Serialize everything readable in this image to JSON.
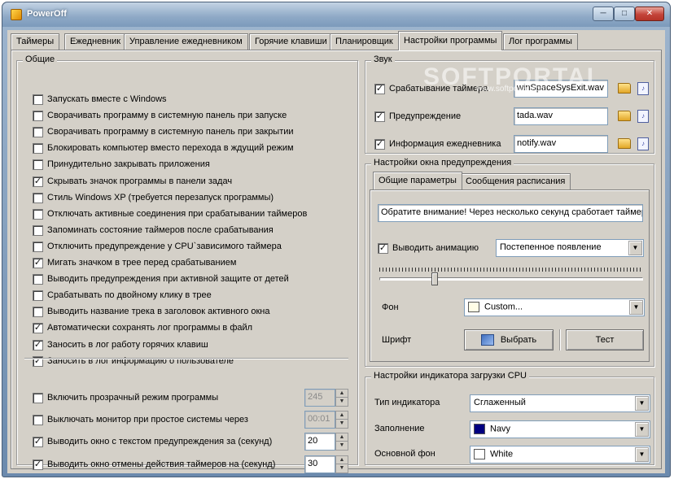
{
  "window": {
    "title": "PowerOff",
    "min_glyph": "─",
    "max_glyph": "□",
    "close_glyph": "✕"
  },
  "tabs": [
    {
      "label": "Таймеры"
    },
    {
      "label": "Ежедневник"
    },
    {
      "label": "Управление ежедневником"
    },
    {
      "label": "Горячие клавиши"
    },
    {
      "label": "Планировщик"
    },
    {
      "label": "Настройки программы",
      "active": true
    },
    {
      "label": "Лог программы"
    }
  ],
  "general": {
    "title": "Общие",
    "checkboxes": [
      {
        "label": "Запускать  вместе с Windows",
        "checked": false
      },
      {
        "label": "Сворачивать программу в системную панель при запуске",
        "checked": false
      },
      {
        "label": "Сворачивать программу в системную панель при закрытии",
        "checked": false
      },
      {
        "label": "Блокировать компьютер вместо перехода в ждущий режим",
        "checked": false
      },
      {
        "label": "Принудительно закрывать приложения",
        "checked": false
      },
      {
        "label": "Скрывать значок программы в панели задач",
        "checked": true
      },
      {
        "label": "Стиль Windows XP (требуется перезапуск программы)",
        "checked": false
      },
      {
        "label": "Отключать активные соединения при срабатывании таймеров",
        "checked": false
      },
      {
        "label": "Запоминать состояние таймеров после срабатывания",
        "checked": false
      },
      {
        "label": "Отключить предупреждение у CPU`зависимого таймера",
        "checked": false
      },
      {
        "label": "Мигать значком в трее перед срабатыванием",
        "checked": true
      },
      {
        "label": "Выводить предупреждения при активной защите от детей",
        "checked": false
      },
      {
        "label": "Срабатывать по двойному клику в трее",
        "checked": false
      },
      {
        "label": "Выводить название трека в заголовок активного окна",
        "checked": false
      },
      {
        "label": "Автоматически сохранять лог программы в файл",
        "checked": true
      },
      {
        "label": "Заносить в лог работу горячих клавиш",
        "checked": true
      },
      {
        "label": "Заносить в лог информацию о пользователе",
        "checked": true
      }
    ],
    "spin_rows": [
      {
        "label": "Включить прозрачный режим программы",
        "checked": false,
        "value": "245",
        "disabled": true
      },
      {
        "label": "Выключать монитор при простое системы через",
        "checked": false,
        "value": "00:01",
        "disabled": true
      },
      {
        "label": "Выводить окно с текстом предупреждения за (секунд)",
        "checked": true,
        "value": "20",
        "disabled": false
      },
      {
        "label": "Выводить окно отмены действия таймеров на (секунд)",
        "checked": true,
        "value": "30",
        "disabled": false
      }
    ]
  },
  "sound": {
    "title": "Звук",
    "rows": [
      {
        "label": "Срабатывание таймера",
        "checked": true,
        "file": "winSpaceSysExit.wav"
      },
      {
        "label": "Предупреждение",
        "checked": true,
        "file": "tada.wav"
      },
      {
        "label": "Информация ежедневника",
        "checked": true,
        "file": "notify.wav"
      }
    ]
  },
  "warning": {
    "title": "Настройки окна предупреждения",
    "subtabs": [
      {
        "label": "Общие параметры",
        "active": true
      },
      {
        "label": "Сообщения расписания"
      }
    ],
    "message": "Обратите внимание! Через несколько секунд сработает таймер",
    "animation_label": "Выводить анимацию",
    "animation_checked": true,
    "animation_value": "Постепенное появление",
    "slider_level": 0.21,
    "bg_label": "Фон",
    "bg_value": "Custom...",
    "bg_color": "#fffde6",
    "font_label": "Шрифт",
    "choose_label": "Выбрать",
    "test_label": "Тест"
  },
  "cpu": {
    "title": "Настройки индикатора загрузки CPU",
    "rows": [
      {
        "label": "Тип индикатора",
        "value": "Сглаженный"
      },
      {
        "label": "Заполнение",
        "value": "Navy",
        "color": "#000080"
      },
      {
        "label": "Основной фон",
        "value": "White",
        "color": "#ffffff"
      }
    ]
  },
  "watermark": {
    "text": "SOFTPORTAL",
    "sub": "www.softportal.com"
  }
}
